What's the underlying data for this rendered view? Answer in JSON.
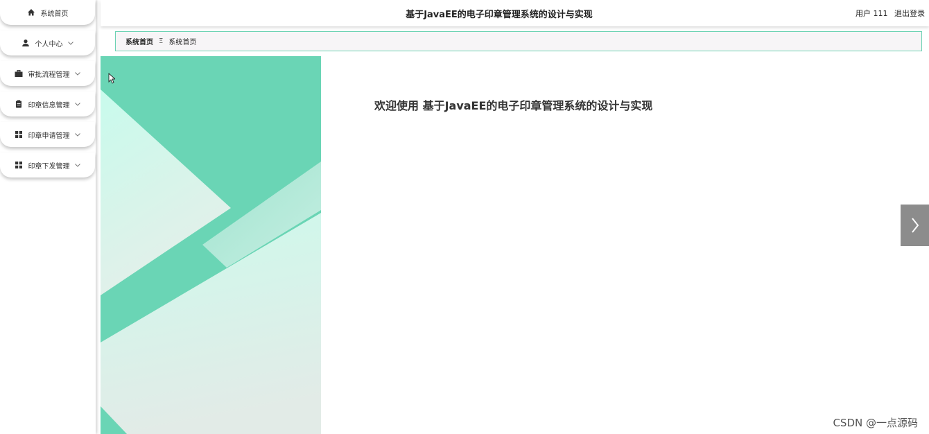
{
  "header": {
    "title": "基于JavaEE的电子印章管理系统的设计与实现",
    "user_prefix": "用户",
    "username": "111",
    "logout_label": "退出登录"
  },
  "sidebar": {
    "items": [
      {
        "label": "系统首页",
        "icon": "home-icon",
        "has_submenu": false
      },
      {
        "label": "个人中心",
        "icon": "user-icon",
        "has_submenu": true
      },
      {
        "label": "审批流程管理",
        "icon": "briefcase-icon",
        "has_submenu": true
      },
      {
        "label": "印章信息管理",
        "icon": "clipboard-icon",
        "has_submenu": true
      },
      {
        "label": "印章申请管理",
        "icon": "grid-icon",
        "has_submenu": true
      },
      {
        "label": "印章下发管理",
        "icon": "grid-icon",
        "has_submenu": true
      }
    ]
  },
  "breadcrumb": {
    "home": "系统首页",
    "separator": "Ξ",
    "current": "系统首页"
  },
  "main": {
    "welcome": "欢迎使用 基于JavaEE的电子印章管理系统的设计与实现"
  },
  "watermark": "CSDN @一点源码",
  "colors": {
    "accent": "#6ad5b5",
    "border": "#6cd2b3",
    "arrow_bg": "#8c8c8c"
  }
}
